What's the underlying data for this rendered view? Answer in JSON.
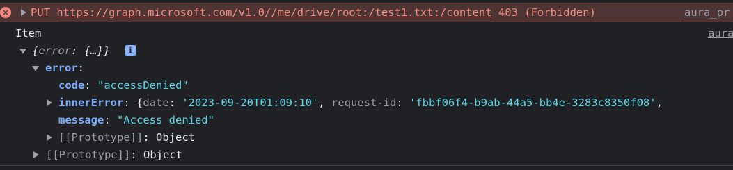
{
  "error_row": {
    "method": "PUT",
    "url": "https://graph.microsoft.com/v1.0//me/drive/root:/test1.txt:/content",
    "status": "403 (Forbidden)",
    "source": "aura_pr"
  },
  "log": {
    "label": "Item",
    "source": "aura"
  },
  "tree": {
    "root_summary": "{error: {…}}",
    "root_open": "{",
    "root_key": "error",
    "root_colon": ": ",
    "root_ellipsis": "{…}",
    "root_close": "}",
    "info_badge": "i",
    "error_key": "error",
    "code_key": "code",
    "code_value": "\"accessDenied\"",
    "inner_key": "innerError",
    "inner_open": "{",
    "inner_date_key": "date",
    "inner_date_value": "'2023-09-20T01:09:10'",
    "inner_reqid_key": "request-id",
    "inner_reqid_value": "'fbbf06f4-b9ab-44a5-bb4e-3283c8350f08'",
    "inner_trailing": ",",
    "message_key": "message",
    "message_value": "\"Access denied\"",
    "proto_key": "[[Prototype]]",
    "proto_value": "Object",
    "outer_proto_key": "[[Prototype]]",
    "outer_proto_value": "Object"
  },
  "colors": {
    "background": "#202124",
    "error_background": "#4e3534",
    "error_text": "#f28b82",
    "key": "#7cacf8",
    "string": "#5cd5e5"
  }
}
